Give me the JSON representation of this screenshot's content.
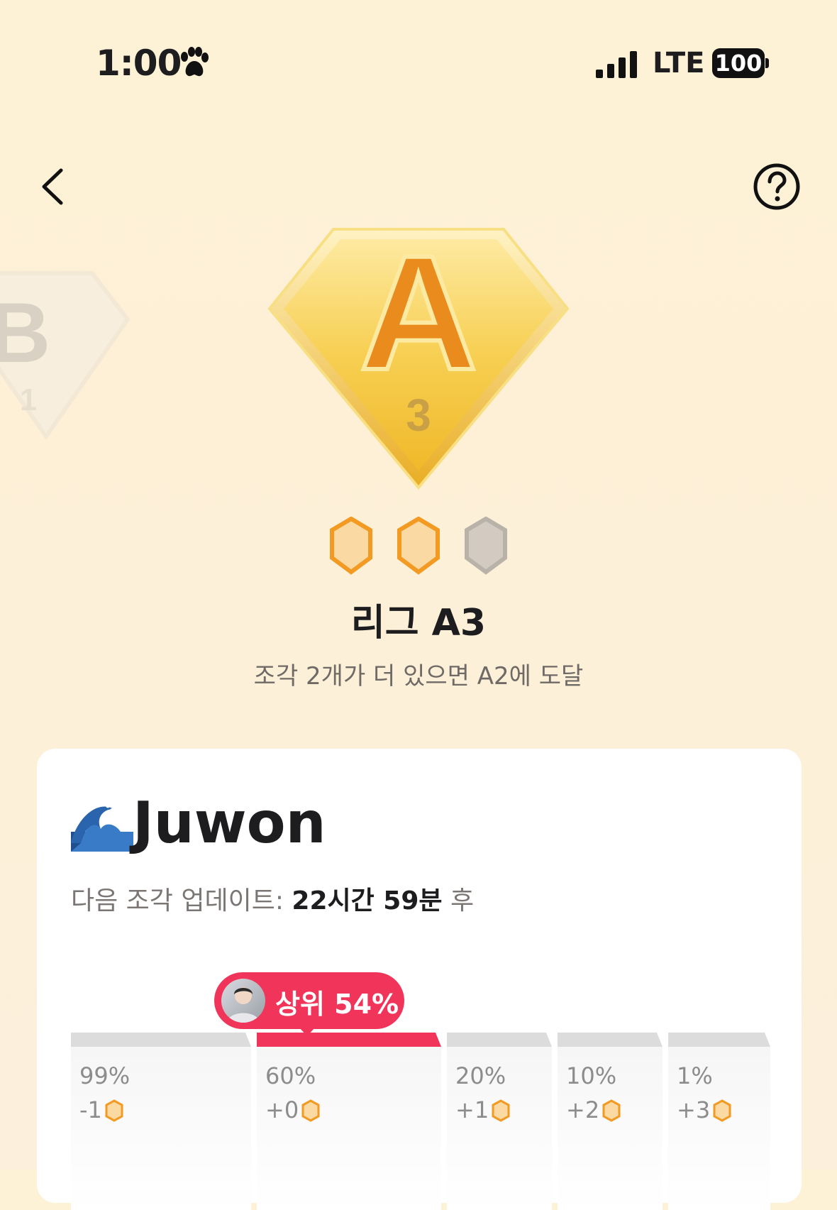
{
  "status_bar": {
    "time": "1:00",
    "network": "LTE",
    "battery": "100"
  },
  "nav": {
    "back_icon": "chevron-left-icon",
    "help_icon": "question-circle-icon"
  },
  "badges": {
    "previous": {
      "letter": "B",
      "number": "1"
    },
    "current": {
      "letter": "A",
      "number": "3"
    }
  },
  "pieces": {
    "filled": 2,
    "total": 3
  },
  "league": {
    "title": "리그 A3",
    "subtitle": "조각 2개가 더 있으면 A2에 도달"
  },
  "user": {
    "name": "Juwon",
    "emoji_icon": "wave-icon",
    "update_label": "다음 조각 업데이트: ",
    "update_value": "22시간 59분",
    "update_suffix": " 후"
  },
  "rank": {
    "label": "상위 54%"
  },
  "tiers": [
    {
      "pct": "99%",
      "delta": "-1"
    },
    {
      "pct": "60%",
      "delta": "+0",
      "active": true
    },
    {
      "pct": "20%",
      "delta": "+1"
    },
    {
      "pct": "10%",
      "delta": "+2"
    },
    {
      "pct": "1%",
      "delta": "+3"
    }
  ],
  "colors": {
    "accent": "#f0345a",
    "gold": "#f5c542",
    "orange": "#ea8b1e"
  }
}
